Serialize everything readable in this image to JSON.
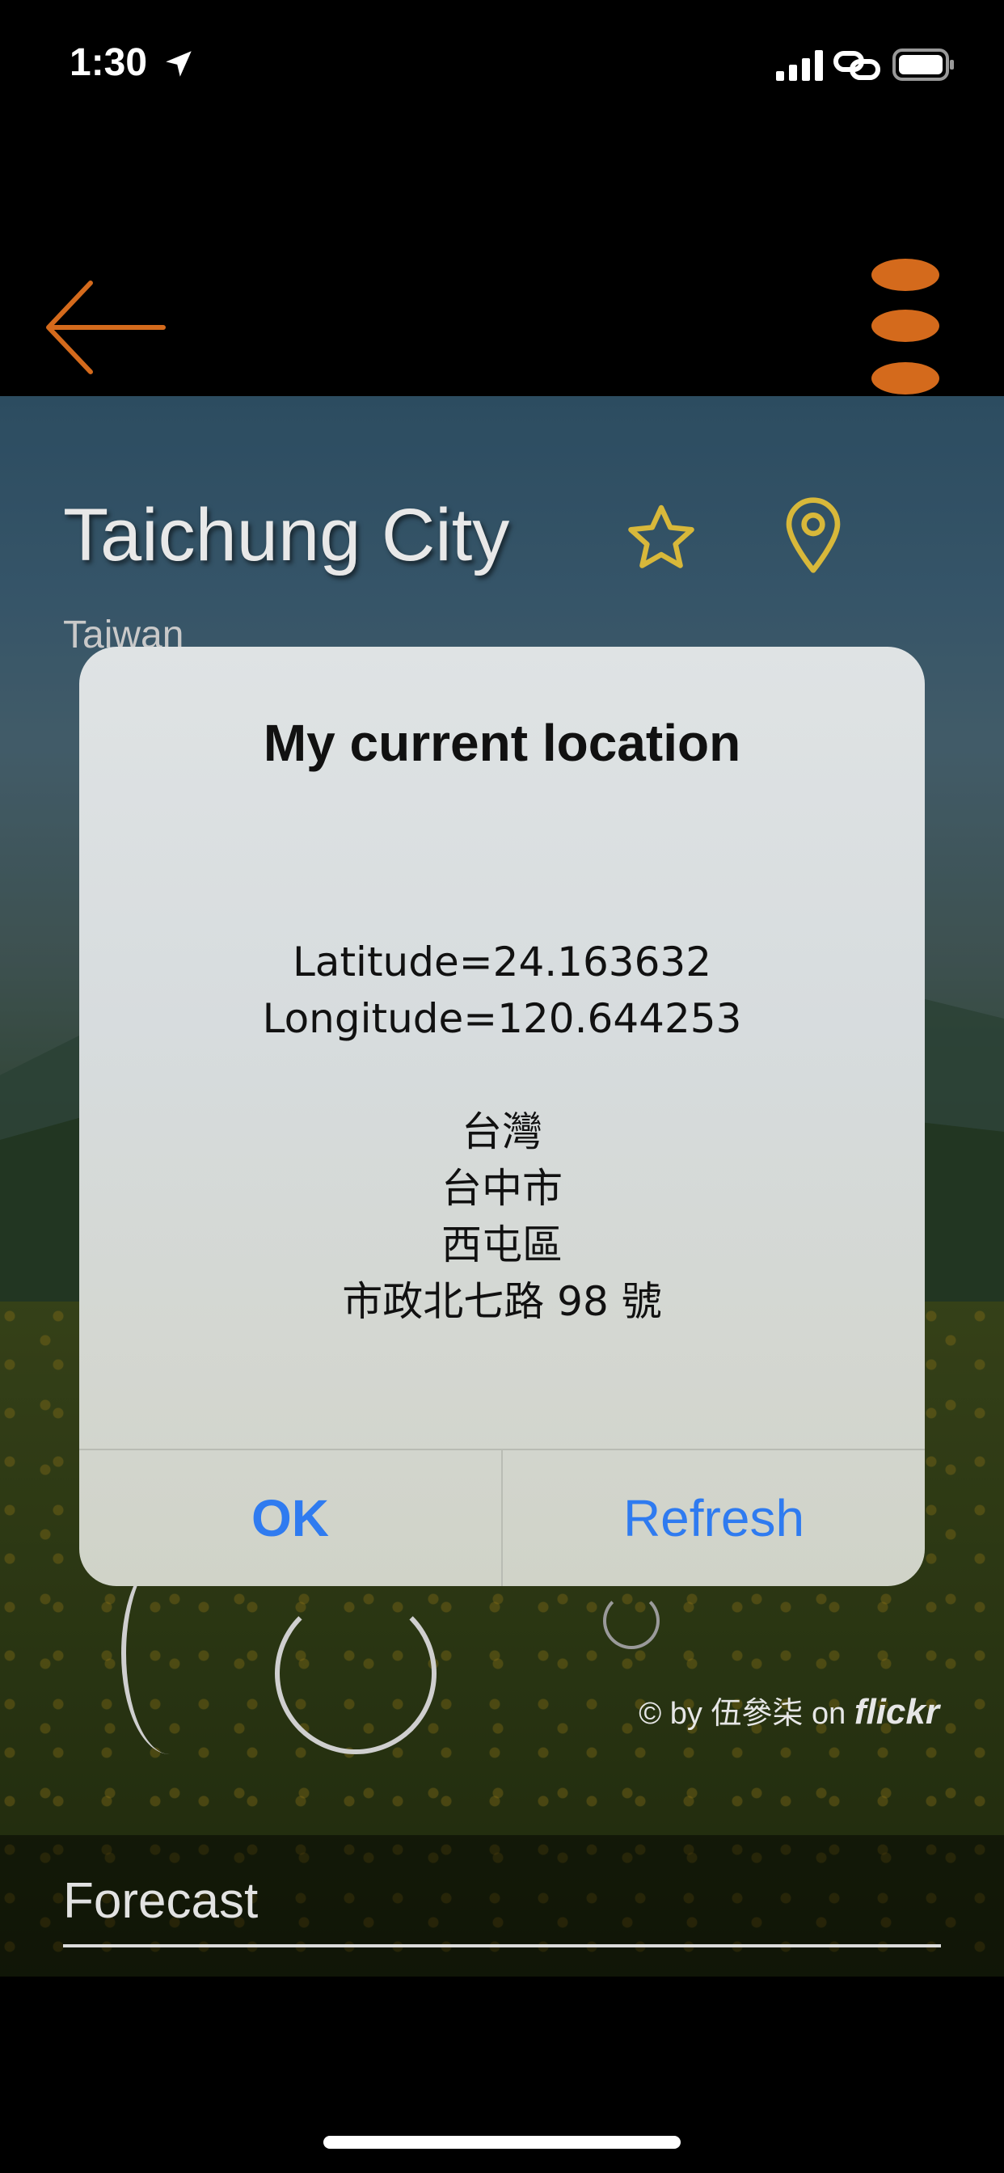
{
  "status_bar": {
    "time": "1:30"
  },
  "colors": {
    "accent_orange": "#d46a1c",
    "icon_yellow": "#d8b83a",
    "alert_button_blue": "#2f7bf0"
  },
  "nav": {
    "back_icon": "arrow-left-icon",
    "menu_icon": "more-vertical-icon"
  },
  "location": {
    "city": "Taichung City",
    "country": "Taiwan"
  },
  "photo_credit": {
    "prefix": "© by 伍參柒 on",
    "brand": "flickr"
  },
  "forecast": {
    "title": "Forecast"
  },
  "alert": {
    "title": "My current location",
    "latitude": "Latitude=24.163632",
    "longitude": "Longitude=120.644253",
    "address_lines": [
      "台灣",
      "台中市",
      "西屯區",
      "市政北七路 98 號"
    ],
    "ok_label": "OK",
    "refresh_label": "Refresh"
  }
}
